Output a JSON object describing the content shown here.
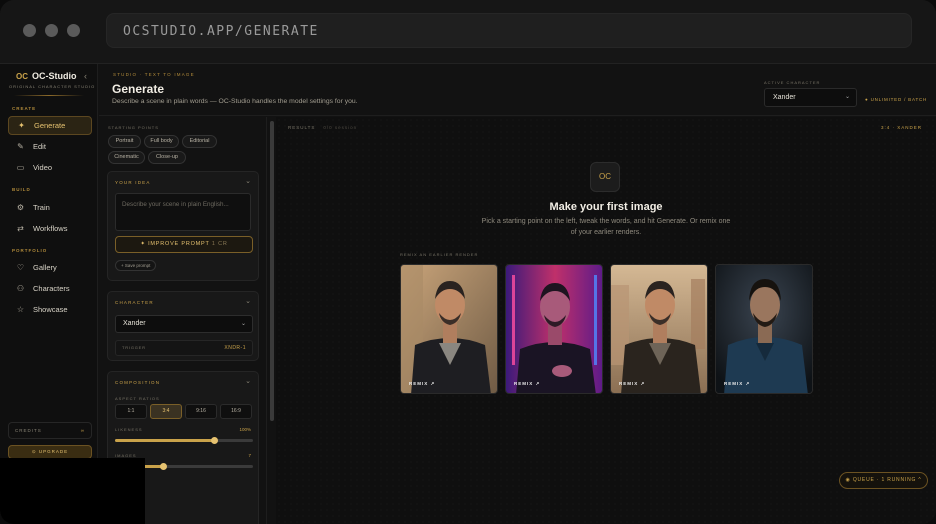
{
  "browser": {
    "url": "OCSTUDIO.APP/GENERATE"
  },
  "brand": {
    "name": "OC-Studio",
    "logo": "OC",
    "tagline": "ORIGINAL CHARACTER STUDIO",
    "collapse_icon": "chevron-left-icon"
  },
  "sidebar": {
    "sections": [
      {
        "label": "CREATE"
      },
      {
        "label": "BUILD"
      },
      {
        "label": "PORTFOLIO"
      }
    ],
    "items": [
      {
        "label": "Generate",
        "icon": "sparkle-icon",
        "active": true
      },
      {
        "label": "Edit",
        "icon": "pencil-icon"
      },
      {
        "label": "Video",
        "icon": "video-icon"
      },
      {
        "label": "Train",
        "icon": "gear-icon"
      },
      {
        "label": "Workflows",
        "icon": "workflow-icon"
      },
      {
        "label": "Gallery",
        "icon": "heart-icon"
      },
      {
        "label": "Characters",
        "icon": "user-icon"
      },
      {
        "label": "Showcase",
        "icon": "star-icon"
      }
    ],
    "credits": {
      "label": "CREDITS",
      "value": "∞"
    },
    "upgrade_label": "⊙ UPGRADE"
  },
  "header": {
    "breadcrumb": "STUDIO · TEXT TO IMAGE",
    "title": "Generate",
    "subtitle": "Describe a scene in plain words — OC-Studio handles the model settings for you.",
    "active_character_label": "ACTIVE CHARACTER",
    "active_character": "Xander",
    "plan": "● UNLIMITED / BATCH"
  },
  "panel": {
    "starting_points_label": "STARTING POINTS",
    "starting_points": [
      "Portrait",
      "Full body",
      "Editorial",
      "Cinematic",
      "Close-up"
    ],
    "idea": {
      "title": "YOUR IDEA",
      "placeholder": "Describe your scene in plain English...",
      "improve_label": "✦ IMPROVE PROMPT",
      "improve_count": "1 CR",
      "save_label": "+ Save prompt"
    },
    "character": {
      "title": "CHARACTER",
      "selected": "Xander",
      "trigger_label": "TRIGGER",
      "trigger_value": "XNDR-1"
    },
    "composition": {
      "title": "COMPOSITION",
      "aspect_label": "ASPECT RATIOS",
      "aspects": [
        "1:1",
        "3:4",
        "9:16",
        "16:9"
      ],
      "selected_aspect": "3:4",
      "likeness_label": "LIKENESS",
      "likeness_value": "100%",
      "likeness_level": 0.72,
      "images_label": "IMAGES",
      "images_value": "7",
      "images_level": 0.35
    }
  },
  "main": {
    "results_label": "RESULTS",
    "results_sub": "0/0 session",
    "ratio": "3:4 · XANDER",
    "logo": "OC",
    "empty_title": "Make your first image",
    "empty_text": "Pick a starting point on the left, tweak the words, and hit Generate. Or remix one of your earlier renders.",
    "remix_label": "REMIX AN EARLIER RENDER",
    "thumbs": [
      {
        "label": "REMIX ↗"
      },
      {
        "label": "REMIX ↗"
      },
      {
        "label": "REMIX ↗"
      },
      {
        "label": "REMIX ↗"
      }
    ],
    "queue": "◉ QUEUE · 1 RUNNING  ^"
  }
}
